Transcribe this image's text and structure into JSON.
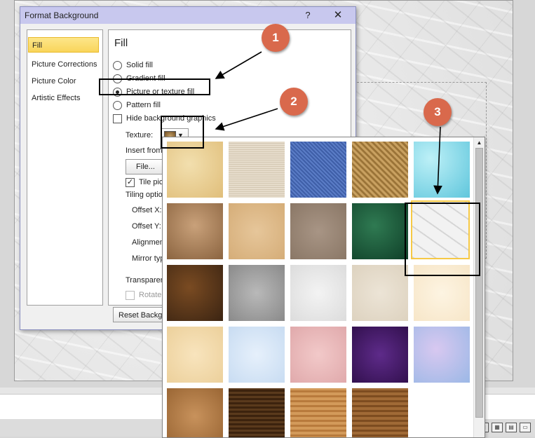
{
  "dialog": {
    "title": "Format Background",
    "help_label": "?",
    "close_label": "✕",
    "nav": [
      {
        "label": "Fill",
        "selected": true
      },
      {
        "label": "Picture Corrections",
        "selected": false
      },
      {
        "label": "Picture Color",
        "selected": false
      },
      {
        "label": "Artistic Effects",
        "selected": false
      }
    ],
    "panel": {
      "heading": "Fill",
      "fill_options": [
        {
          "label": "Solid fill",
          "selected": false
        },
        {
          "label": "Gradient fill",
          "selected": false
        },
        {
          "label": "Picture or texture fill",
          "selected": true
        },
        {
          "label": "Pattern fill",
          "selected": false
        }
      ],
      "hide_graphics": {
        "label": "Hide background graphics",
        "checked": false
      },
      "texture_label": "Texture:",
      "insert_from_label": "Insert from",
      "file_button": "File...",
      "tile_label": "Tile pict",
      "tile_checked": true,
      "tiling_options_label": "Tiling option",
      "offset_x_label": "Offset X:",
      "offset_y_label": "Offset Y:",
      "alignment_label": "Alignmen",
      "mirror_label": "Mirror typ",
      "transparency_label": "Transparen",
      "rotate_label": "Rotate"
    },
    "reset_button": "Reset Backgr"
  },
  "gallery": {
    "textures": [
      "papyrus",
      "canvas",
      "denim",
      "woven-mat",
      "water-droplets",
      "brown-paper-bag",
      "fish-fossil",
      "sand",
      "green-marble",
      "white-marble",
      "brown-marble",
      "granite",
      "newsprint",
      "recycled-paper",
      "parchment",
      "stationery",
      "blue-tissue-paper",
      "pink-tissue-paper",
      "purple-mesh",
      "bouquet",
      "cork",
      "walnut",
      "oak",
      "medium-wood"
    ],
    "selected": "white-marble",
    "colors": {
      "selection_border": "#f6c945"
    }
  },
  "annotations": [
    {
      "label": "1"
    },
    {
      "label": "2"
    },
    {
      "label": "3"
    }
  ],
  "colors": {
    "badge": "#d9694c",
    "titlebar": "#c8c8ee"
  }
}
